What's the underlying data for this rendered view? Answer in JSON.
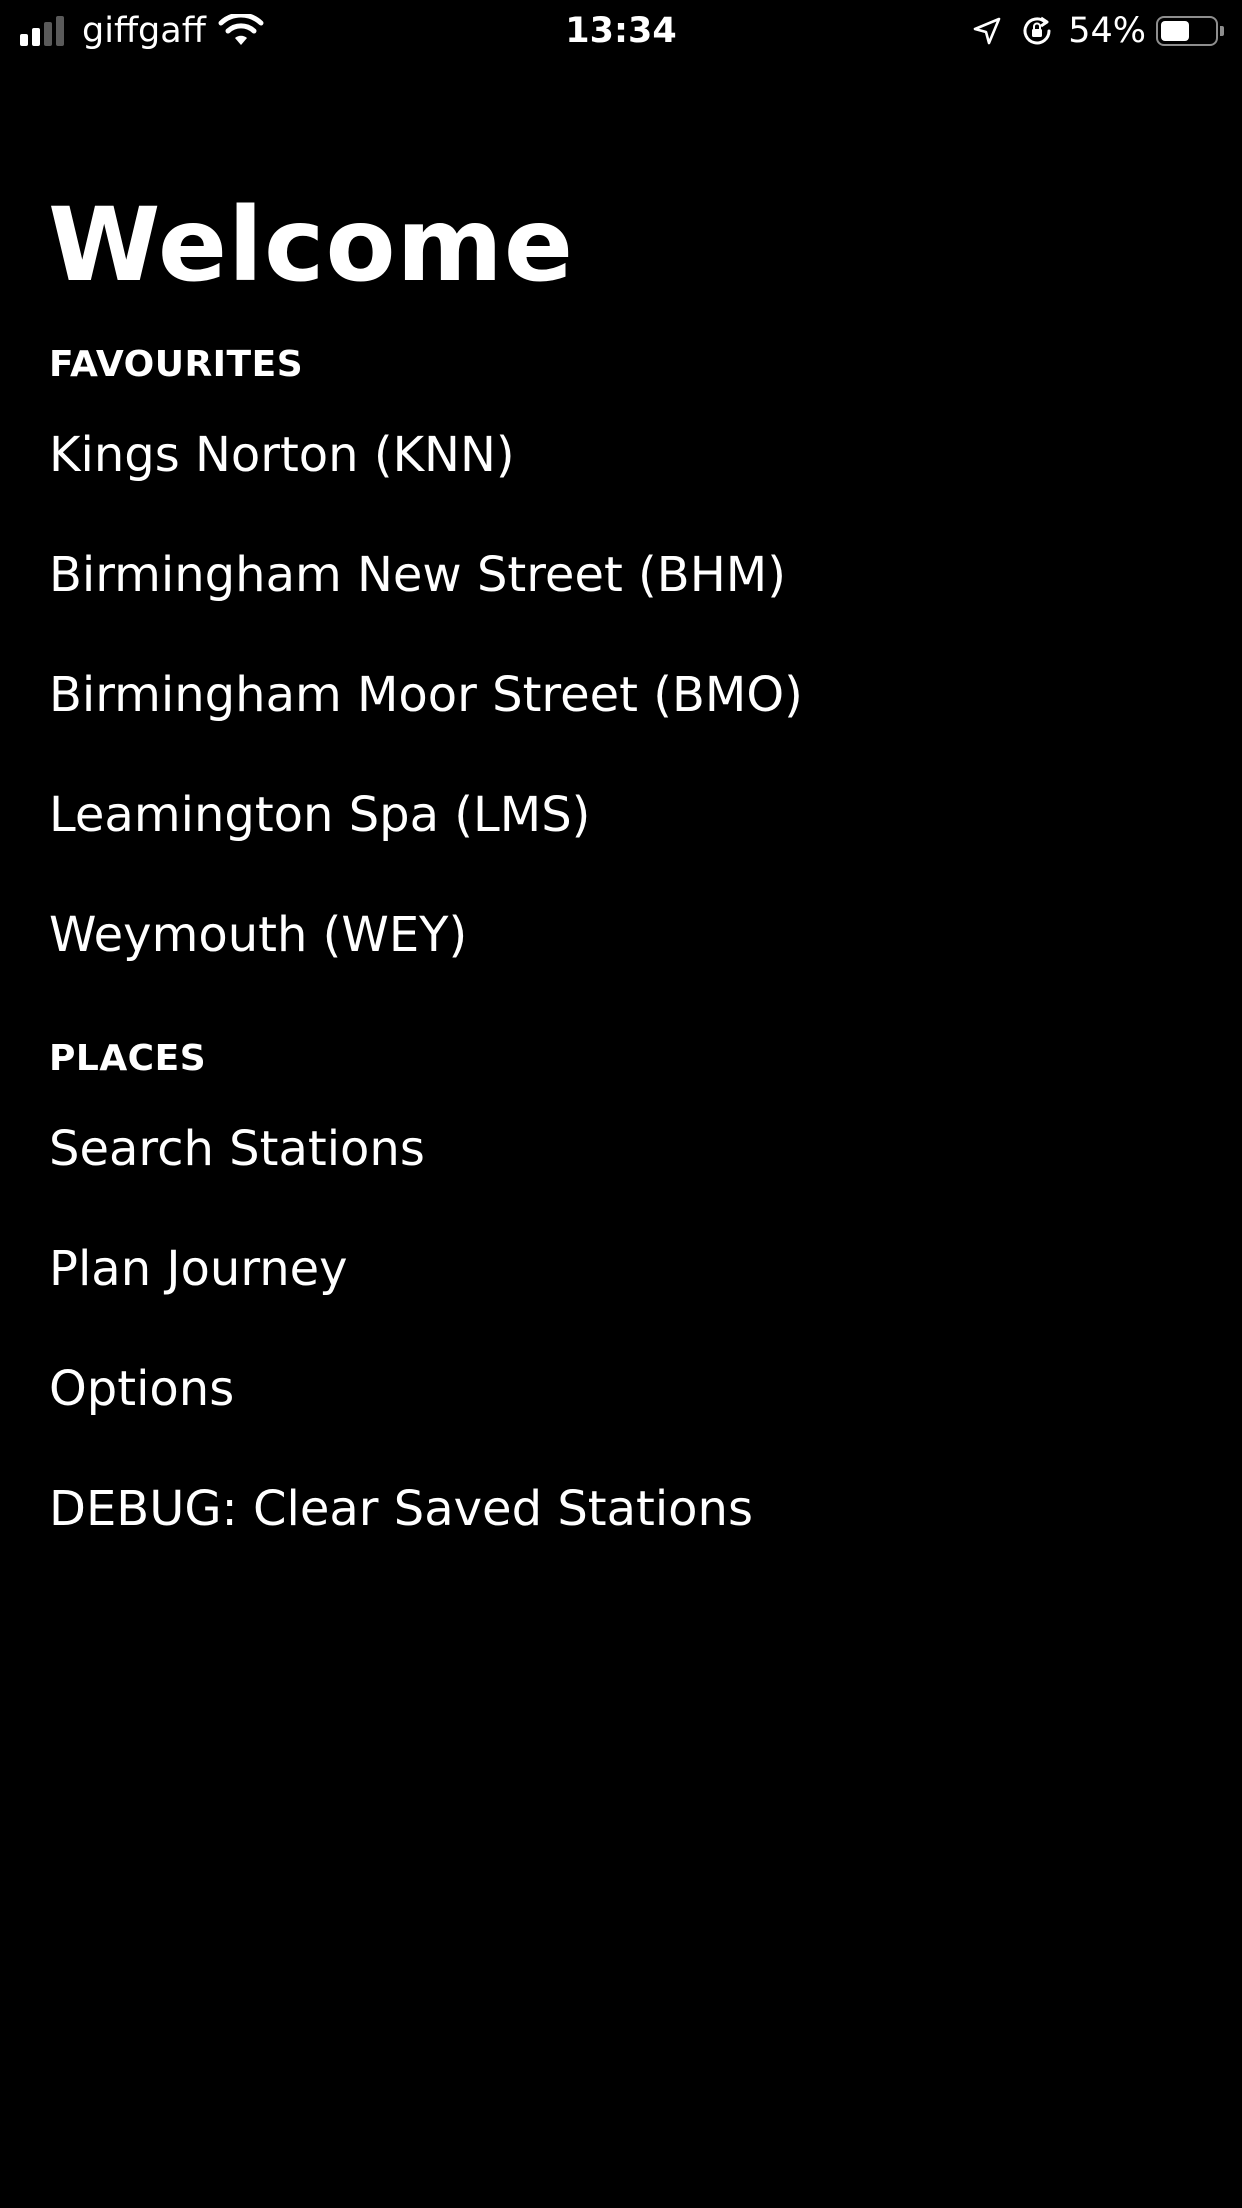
{
  "status_bar": {
    "carrier": "giffgaff",
    "time": "13:34",
    "battery_percent_label": "54%",
    "battery_level": 0.54,
    "signal_bars_filled": 2,
    "signal_bars_total": 4,
    "icons": [
      "signal-icon",
      "wifi-icon",
      "location-arrow-icon",
      "orientation-lock-icon",
      "battery-icon"
    ]
  },
  "page": {
    "title": "Welcome"
  },
  "favourites": {
    "header": "FAVOURITES",
    "items": [
      {
        "label": "Kings Norton (KNN)"
      },
      {
        "label": "Birmingham New Street (BHM)"
      },
      {
        "label": "Birmingham Moor Street (BMO)"
      },
      {
        "label": "Leamington Spa (LMS)"
      },
      {
        "label": "Weymouth (WEY)"
      }
    ]
  },
  "places": {
    "header": "PLACES",
    "items": [
      {
        "label": "Search Stations"
      },
      {
        "label": "Plan Journey"
      },
      {
        "label": "Options"
      },
      {
        "label": "DEBUG: Clear Saved Stations"
      }
    ]
  },
  "colors": {
    "background": "#000000",
    "text": "#ffffff",
    "signal_dim": "#5a5a5a"
  }
}
